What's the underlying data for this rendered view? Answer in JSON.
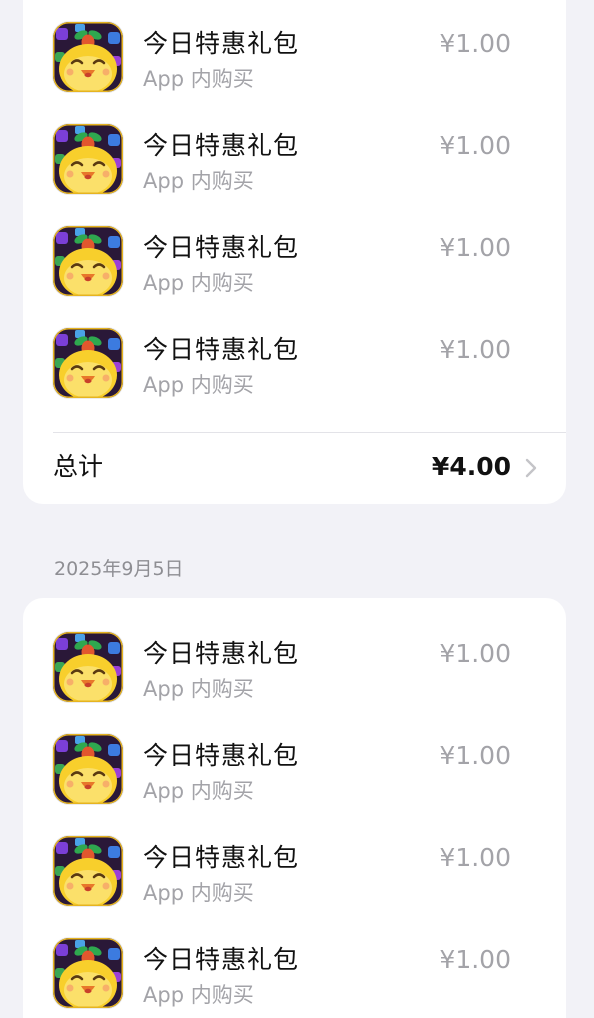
{
  "section1": {
    "items": [
      {
        "title": "今日特惠礼包",
        "subtitle": "App 内购买",
        "price": "¥1.00",
        "icon": "chick-game-icon"
      },
      {
        "title": "今日特惠礼包",
        "subtitle": "App 内购买",
        "price": "¥1.00",
        "icon": "chick-game-icon"
      },
      {
        "title": "今日特惠礼包",
        "subtitle": "App 内购买",
        "price": "¥1.00",
        "icon": "chick-game-icon"
      },
      {
        "title": "今日特惠礼包",
        "subtitle": "App 内购买",
        "price": "¥1.00",
        "icon": "chick-game-icon"
      }
    ],
    "total_label": "总计",
    "total_value": "¥4.00"
  },
  "section2": {
    "date": "2025年9月5日",
    "items": [
      {
        "title": "今日特惠礼包",
        "subtitle": "App 内购买",
        "price": "¥1.00",
        "icon": "chick-game-icon"
      },
      {
        "title": "今日特惠礼包",
        "subtitle": "App 内购买",
        "price": "¥1.00",
        "icon": "chick-game-icon"
      },
      {
        "title": "今日特惠礼包",
        "subtitle": "App 内购买",
        "price": "¥1.00",
        "icon": "chick-game-icon"
      },
      {
        "title": "今日特惠礼包",
        "subtitle": "App 内购买",
        "price": "¥1.00",
        "icon": "chick-game-icon"
      }
    ]
  },
  "colors": {
    "background": "#f2f2f7",
    "card": "#ffffff",
    "primary_text": "#111111",
    "secondary_text": "#a3a3a8",
    "icon_background": "#2a1838",
    "chick_yellow": "#f8cf2c"
  }
}
